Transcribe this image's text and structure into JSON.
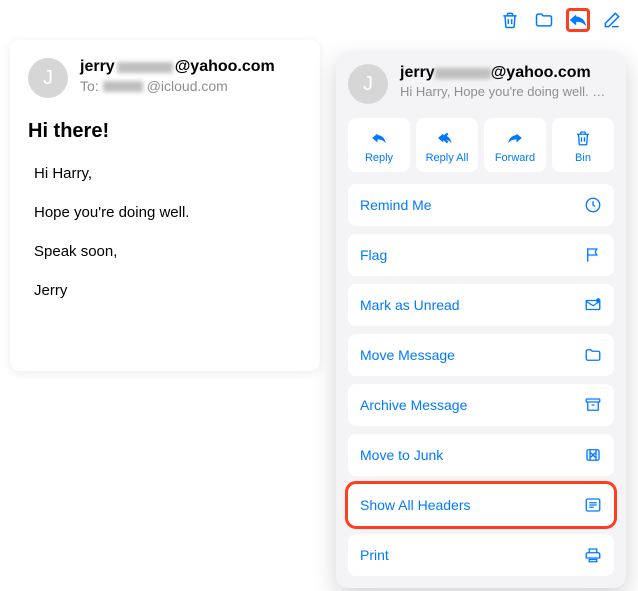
{
  "toolbar": {
    "trash": "trash",
    "move": "folder",
    "reply": "reply",
    "compose": "compose"
  },
  "email": {
    "avatar_initial": "J",
    "from_prefix": "jerry",
    "from_suffix": "@yahoo.com",
    "to_label": "To:",
    "to_suffix": "@icloud.com",
    "subject": "Hi there!",
    "body": {
      "p1": "Hi Harry,",
      "p2": "Hope you're doing well.",
      "p3": "Speak soon,",
      "p4": "Jerry"
    }
  },
  "popup": {
    "avatar_initial": "J",
    "from_prefix": "jerry",
    "from_suffix": "@yahoo.com",
    "preview": "Hi Harry, Hope you're doing well. …",
    "actions": {
      "reply": "Reply",
      "reply_all": "Reply All",
      "forward": "Forward",
      "bin": "Bin"
    },
    "menu": {
      "remind": "Remind Me",
      "flag": "Flag",
      "unread": "Mark as Unread",
      "move": "Move Message",
      "archive": "Archive Message",
      "junk": "Move to Junk",
      "headers": "Show All Headers",
      "print": "Print"
    }
  }
}
